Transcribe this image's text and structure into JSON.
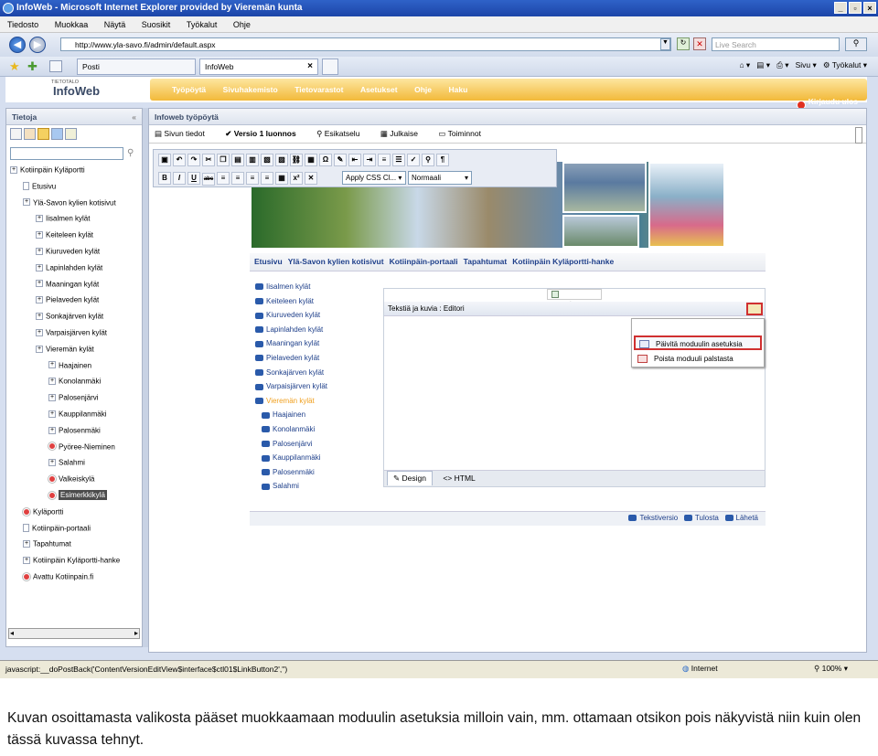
{
  "window": {
    "title": "InfoWeb - Microsoft Internet Explorer provided by Vieremän kunta"
  },
  "menubar": [
    "Tiedosto",
    "Muokkaa",
    "Näytä",
    "Suosikit",
    "Työkalut",
    "Ohje"
  ],
  "address": {
    "url": "http://www.yla-savo.fi/admin/default.aspx",
    "search_placeholder": "Live Search"
  },
  "tabs": {
    "posti": "Posti",
    "infoweb": "InfoWeb",
    "close": "×"
  },
  "ie_tools": {
    "sivu": "Sivu",
    "tyokalut": "Työkalut"
  },
  "app": {
    "logo_small": "TIETOTALO",
    "logo": "InfoWeb",
    "nav": [
      "Työpöytä",
      "Sivuhakemisto",
      "Tietovarastot",
      "Asetukset",
      "Ohje",
      "Haku"
    ],
    "logout": "Kirjaudu ulos"
  },
  "left": {
    "title": "Tietoja",
    "collapse": "«",
    "tree": [
      {
        "label": "Kotiinpäin Kyläportti",
        "indent": 0,
        "kind": "box"
      },
      {
        "label": "Etusivu",
        "indent": 1,
        "kind": "pg"
      },
      {
        "label": "Ylä-Savon kylien kotisivut",
        "indent": 1,
        "kind": "box"
      },
      {
        "label": "Iisalmen kylät",
        "indent": 2,
        "kind": "box"
      },
      {
        "label": "Keiteleen kylät",
        "indent": 2,
        "kind": "box"
      },
      {
        "label": "Kiuruveden kylät",
        "indent": 2,
        "kind": "box"
      },
      {
        "label": "Lapinlahden kylät",
        "indent": 2,
        "kind": "box"
      },
      {
        "label": "Maaningan kylät",
        "indent": 2,
        "kind": "box"
      },
      {
        "label": "Pielaveden kylät",
        "indent": 2,
        "kind": "box"
      },
      {
        "label": "Sonkajärven kylät",
        "indent": 2,
        "kind": "box"
      },
      {
        "label": "Varpaisjärven kylät",
        "indent": 2,
        "kind": "box"
      },
      {
        "label": "Vieremän kylät",
        "indent": 2,
        "kind": "box"
      },
      {
        "label": "Haajainen",
        "indent": 3,
        "kind": "box"
      },
      {
        "label": "Konolanmäki",
        "indent": 3,
        "kind": "box"
      },
      {
        "label": "Palosenjärvi",
        "indent": 3,
        "kind": "box"
      },
      {
        "label": "Kauppilanmäki",
        "indent": 3,
        "kind": "box"
      },
      {
        "label": "Palosenmäki",
        "indent": 3,
        "kind": "box"
      },
      {
        "label": "Pyöree-Nieminen",
        "indent": 3,
        "kind": "rd"
      },
      {
        "label": "Salahmi",
        "indent": 3,
        "kind": "box"
      },
      {
        "label": "Valkeiskylä",
        "indent": 3,
        "kind": "rd"
      },
      {
        "label": "Esimerkkikylä",
        "indent": 3,
        "kind": "rd",
        "selected": true
      },
      {
        "label": "Kyläportti",
        "indent": 1,
        "kind": "rd"
      },
      {
        "label": "Kotiinpäin-portaali",
        "indent": 1,
        "kind": "pg"
      },
      {
        "label": "Tapahtumat",
        "indent": 1,
        "kind": "box"
      },
      {
        "label": "Kotiinpäin Kyläportti-hanke",
        "indent": 1,
        "kind": "box"
      },
      {
        "label": "Avattu Kotiinpain.fi",
        "indent": 1,
        "kind": "rd"
      }
    ]
  },
  "main": {
    "title": "Infoweb työpöytä",
    "toolbar": {
      "sivun_tiedot": "Sivun tiedot",
      "versio": "Versio 1 luonnos",
      "esikatselu": "Esikatselu",
      "julkaise": "Julkaise",
      "toiminnot": "Toiminnot"
    },
    "rte": {
      "css": "Apply CSS Cl...",
      "format": "Normaali"
    },
    "sitenav": [
      "Etusivu",
      "Ylä-Savon kylien kotisivut",
      "Kotiinpäin-portaali",
      "Tapahtumat",
      "Kotiinpäin Kyläportti-hanke"
    ],
    "sitemenu": [
      {
        "label": "Iisalmen kylät",
        "sub": false
      },
      {
        "label": "Keiteleen kylät",
        "sub": false
      },
      {
        "label": "Kiuruveden kylät",
        "sub": false
      },
      {
        "label": "Lapinlahden kylät",
        "sub": false
      },
      {
        "label": "Maaningan kylät",
        "sub": false
      },
      {
        "label": "Pielaveden kylät",
        "sub": false
      },
      {
        "label": "Sonkajärven kylät",
        "sub": false
      },
      {
        "label": "Varpaisjärven kylät",
        "sub": false
      },
      {
        "label": "Vieremän kylät",
        "sub": false,
        "active": true
      },
      {
        "label": "Haajainen",
        "sub": true
      },
      {
        "label": "Konolanmäki",
        "sub": true
      },
      {
        "label": "Palosenjärvi",
        "sub": true
      },
      {
        "label": "Kauppilanmäki",
        "sub": true
      },
      {
        "label": "Palosenmäki",
        "sub": true
      },
      {
        "label": "Salahmi",
        "sub": true
      }
    ],
    "editor": {
      "column": "rw_column_1",
      "header": "Tekstiä ja kuvia : Editori",
      "menu": [
        "Päivitä moduulin asetuksia",
        "Poista moduuli palstasta"
      ],
      "tab_design": "Design",
      "tab_html": "HTML"
    },
    "footlinks": [
      "Tekstiversio",
      "Tulosta",
      "Lähetä"
    ]
  },
  "status": {
    "text": "javascript:__doPostBack('ContentVersionEditView$interface$ctl01$LinkButton2','')",
    "zone": "Internet",
    "zoom": "100%"
  },
  "caption": "Kuvan osoittamasta valikosta pääset muokkaamaan moduulin asetuksia milloin vain, mm. ottamaan otsikon pois näkyvistä niin kuin olen tässä kuvassa tehnyt."
}
